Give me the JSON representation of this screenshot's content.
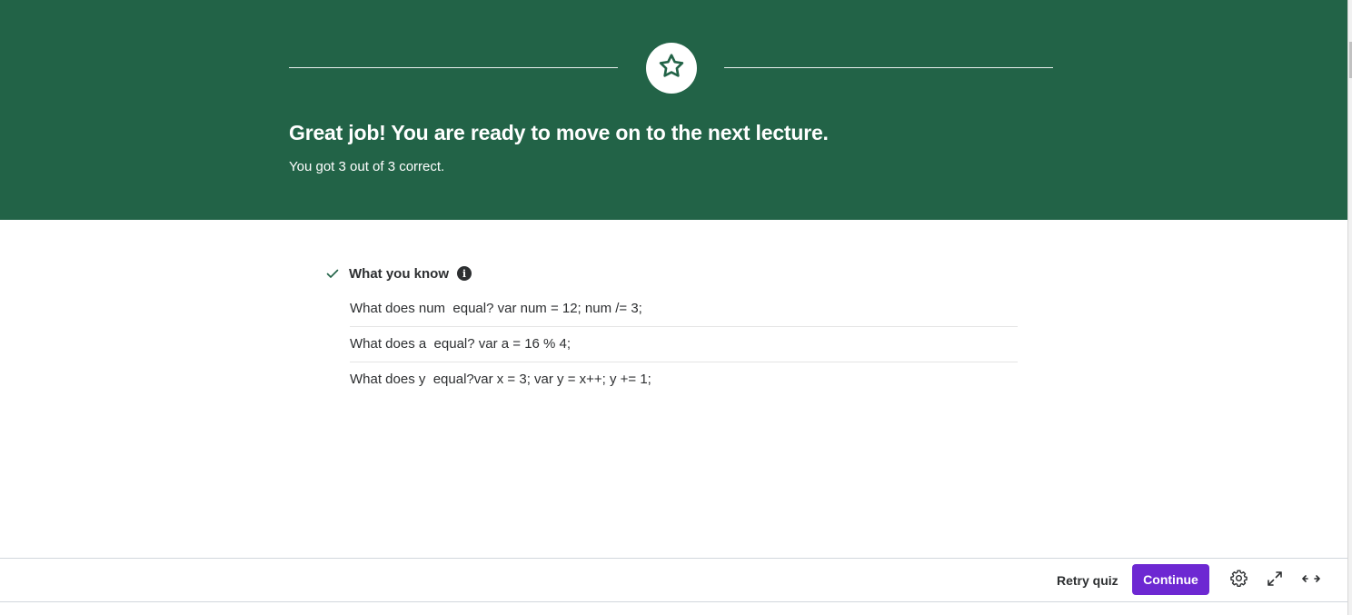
{
  "banner": {
    "title": "Great job! You are ready to move on to the next lecture.",
    "subtitle": "You got 3 out of 3 correct.",
    "icon": "star-icon",
    "background_color": "#226347"
  },
  "knowledge": {
    "title": "What you know",
    "check_icon": "check-icon",
    "info_icon": "info-icon",
    "info_glyph": "i",
    "questions": [
      "What does num  equal? var num = 12; num /= 3;",
      "What does a  equal? var a = 16 % 4;",
      "What does y  equal?var x = 3; var y = x++; y += 1;"
    ]
  },
  "footer": {
    "retry_label": "Retry quiz",
    "continue_label": "Continue",
    "continue_color": "#6d28d2",
    "icons": [
      "gear-icon",
      "expand-icon",
      "wide-view-icon"
    ]
  }
}
